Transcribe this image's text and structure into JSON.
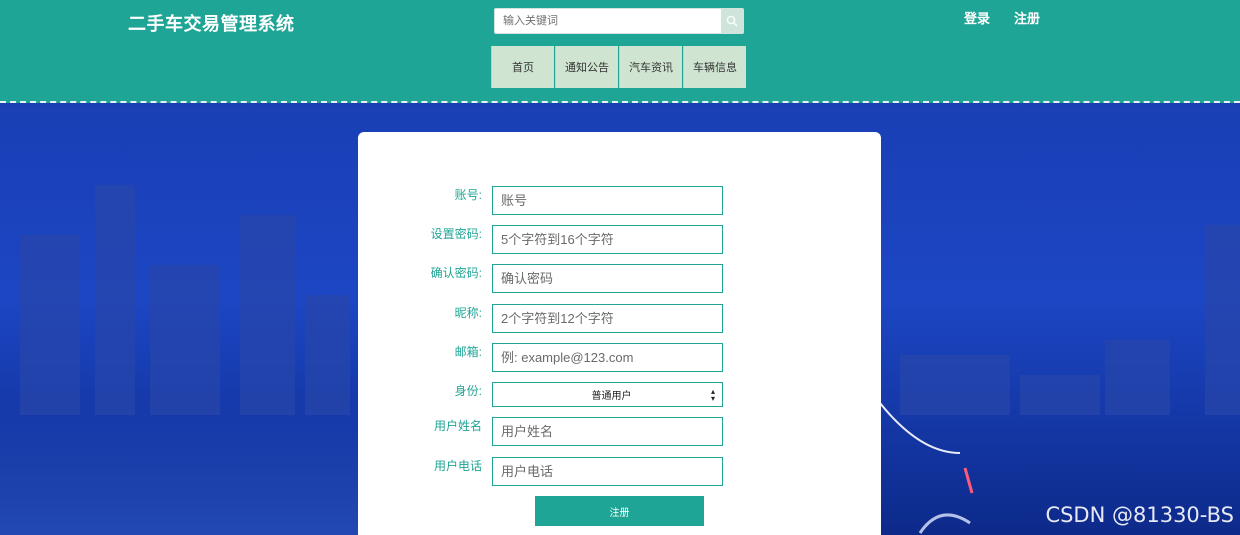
{
  "header": {
    "brand": "二手车交易管理系统",
    "search_placeholder": "输入关键词",
    "links": {
      "login": "登录",
      "register": "注册"
    },
    "nav": [
      "首页",
      "通知公告",
      "汽车资讯",
      "车辆信息"
    ]
  },
  "form": {
    "fields": [
      {
        "label": "账号:",
        "placeholder": "账号"
      },
      {
        "label": "设置密码:",
        "placeholder": "5个字符到16个字符"
      },
      {
        "label": "确认密码:",
        "placeholder": "确认密码"
      },
      {
        "label": "昵称:",
        "placeholder": "2个字符到12个字符"
      },
      {
        "label": "邮箱:",
        "placeholder": "例: example@123.com"
      }
    ],
    "role": {
      "label": "身份:",
      "value": "普通用户"
    },
    "fields2": [
      {
        "label": "用户姓名",
        "placeholder": "用户姓名"
      },
      {
        "label": "用户电话",
        "placeholder": "用户电话"
      }
    ],
    "submit_label": "注册"
  },
  "watermark": "CSDN @81330-BS",
  "colors": {
    "accent": "#1fa595",
    "nav_bg": "#cfe5d1",
    "background": "#1c46c4"
  }
}
